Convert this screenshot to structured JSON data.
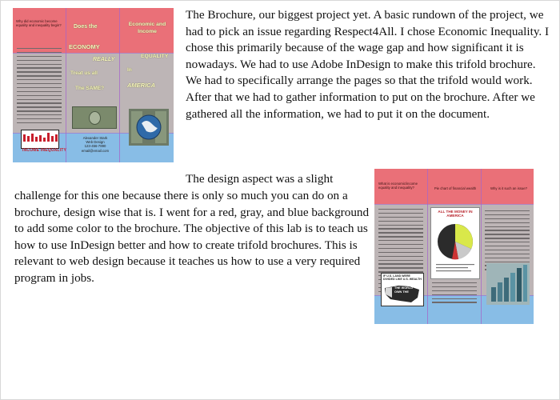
{
  "intro_paragraph": "The Brochure, our biggest project yet. A basic rundown of the project, we had to pick an issue regarding Respect4All. I chose Economic Inequality. I chose this primarily because of the wage gap and how significant it is nowadays. We had to use Adobe InDesign to make this trifold brochure. We had to specifically arrange the pages so that the trifold would work. After that we had to gather information to put on the brochure. After we gathered all the information, we had to put it on the document.",
  "design_paragraph": {
    "first_line": "The design aspect was a slight",
    "rest": "challenge for this one because there is only so much you can do on a brochure, design wise that is. I went for a red, gray, and blue background to add some color to the brochure. The objective of this lab is to teach us how to use InDesign better and how to create trifold brochures. This is relevant to web design because it teaches us how to use a very required program in jobs."
  },
  "brochure_outside": {
    "panel1_title": "Why did economic become equality and inequality begin?",
    "panel1_logo_label": "INCOME INEQUALITY",
    "panel2_words": [
      "Does the",
      "ECONOMY",
      "REALLY",
      "Treat us all",
      "The SAME?"
    ],
    "panel3_title": "Economic and Income",
    "panel3_words": [
      "EQUALITY",
      "In",
      "AMERICA"
    ],
    "panel2_contact": [
      "Alexander Stark",
      "Web Design",
      "123-456-7890",
      "email@email.com"
    ]
  },
  "brochure_inside": {
    "panel1_title": "What is economic/income equality and inequality?",
    "panel2_title": "Pie chart of financial wealth",
    "panel3_title": "Why is it such an issue?",
    "chart_caption": "ALL THE MONEY IN AMERICA",
    "map_label": "THE WORLD OWN THE",
    "slogan": "IF U.S. LAND WERE DIVIDED LIKE U.S. WEALTH"
  },
  "colors": {
    "top_band": "#ea7078",
    "middle_band": "#bdb5b6",
    "bottom_band": "#88bde6"
  }
}
